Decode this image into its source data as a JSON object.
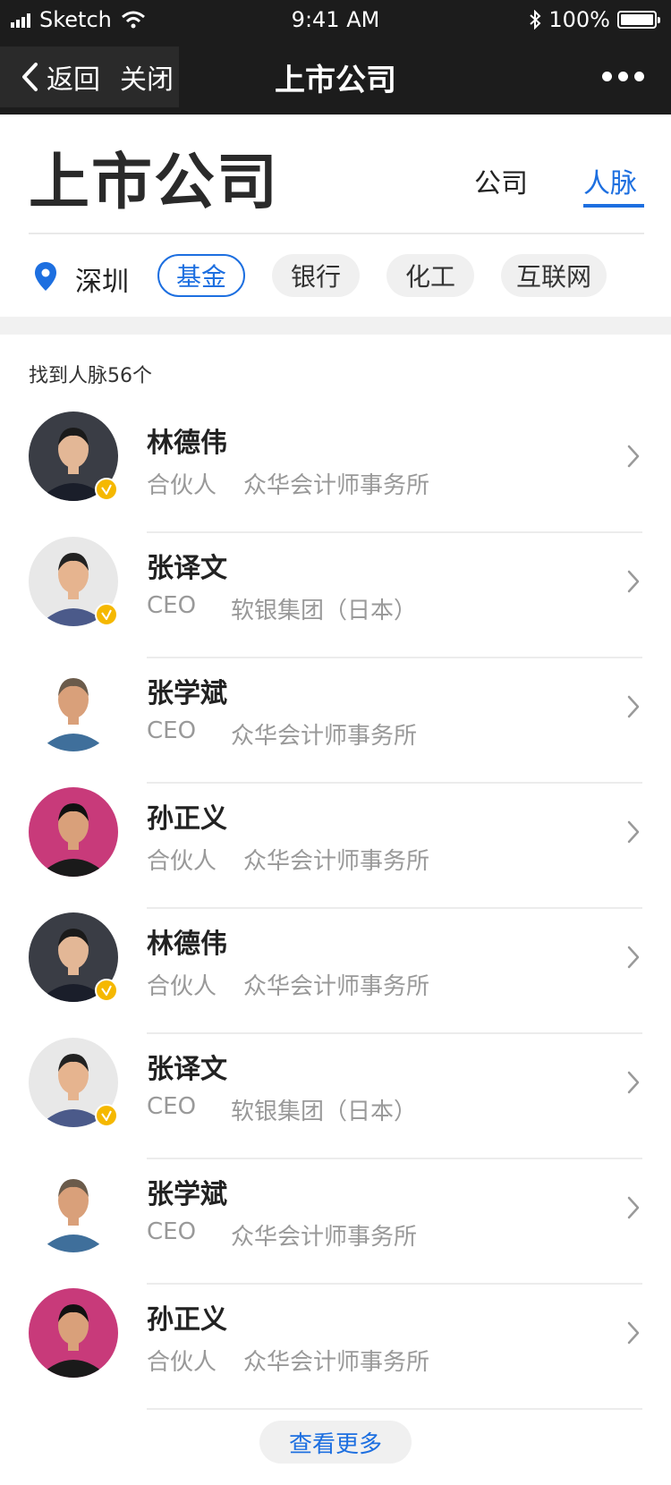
{
  "status_bar": {
    "carrier": "Sketch",
    "time": "9:41 AM",
    "battery": "100%"
  },
  "nav": {
    "back_label": "返回",
    "close_label": "关闭",
    "title": "上市公司"
  },
  "header": {
    "heading": "上市公司",
    "tabs": [
      {
        "label": "公司"
      },
      {
        "label": "人脉"
      }
    ],
    "active_tab": "人脉"
  },
  "filters": {
    "location": "深圳",
    "chips": [
      {
        "label": "基金",
        "active": true
      },
      {
        "label": "银行",
        "active": false
      },
      {
        "label": "化工",
        "active": false
      },
      {
        "label": "互联网",
        "active": false
      }
    ]
  },
  "results": {
    "count_text": "找到人脉56个",
    "people": [
      {
        "name": "林德伟",
        "title": "合伙人",
        "company": "众华会计师事务所",
        "verified": true
      },
      {
        "name": "张译文",
        "title": "CEO",
        "company": "软银集团（日本）",
        "verified": true
      },
      {
        "name": "张学斌",
        "title": "CEO",
        "company": "众华会计师事务所",
        "verified": false
      },
      {
        "name": "孙正义",
        "title": "合伙人",
        "company": "众华会计师事务所",
        "verified": false
      },
      {
        "name": "林德伟",
        "title": "合伙人",
        "company": "众华会计师事务所",
        "verified": true
      },
      {
        "name": "张译文",
        "title": "CEO",
        "company": "软银集团（日本）",
        "verified": true
      },
      {
        "name": "张学斌",
        "title": "CEO",
        "company": "众华会计师事务所",
        "verified": false
      },
      {
        "name": "孙正义",
        "title": "合伙人",
        "company": "众华会计师事务所",
        "verified": false
      }
    ]
  },
  "footer": {
    "load_more_label": "查看更多"
  },
  "colors": {
    "accent": "#1d6fe0",
    "nav_bg": "#1c1c1c",
    "badge": "#f5b800"
  },
  "icons": {
    "location": "location-pin-icon",
    "chevron": "chevron-right-icon",
    "verified": "verified-badge-icon"
  }
}
